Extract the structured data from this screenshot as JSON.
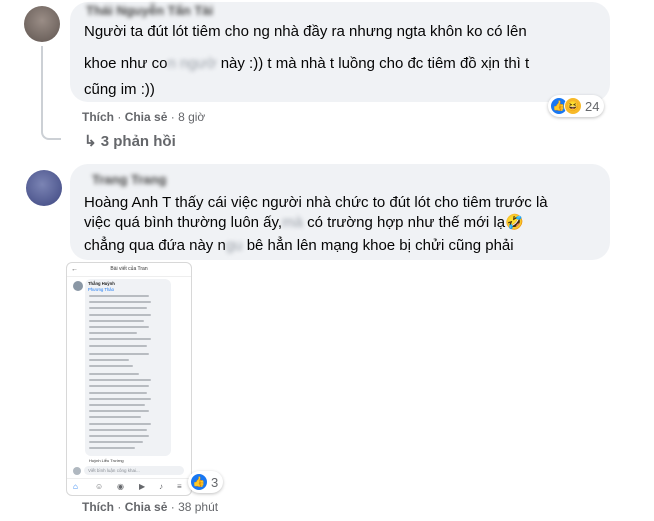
{
  "comment1": {
    "author": "Thái Nguyễn Tấn Tài",
    "lines": [
      "Người ta đút lót tiêm cho ng nhà đầy ra nhưng ngta khôn ko có lên",
      "khoe như co",
      "này :)) t mà nhà t luồng cho đc tiêm đồ xịn thì t",
      "cũng im :))"
    ],
    "blurred_fragment": "n ngườ",
    "like_label": "Thích",
    "share_label": "Chia sẻ",
    "time": "8 giờ",
    "reaction_count": "24",
    "reaction_icons": [
      "like-icon",
      "haha-icon"
    ],
    "replies_label": "3 phản hồi"
  },
  "comment2": {
    "author": "Trang Trang",
    "lines": [
      "Hoàng Anh T thấy cái việc người nhà chức to đút lót cho tiêm trước là",
      "việc quá bình thường luôn ấy,",
      "có trường hợp như thế mới lạ",
      "chẳng qua đứa này n",
      "bê hẳn lên mạng khoe bị chửi cũng phải"
    ],
    "blur_a": "mà",
    "blur_b": "gu",
    "mention_prefix": "Hoàng Anh",
    "like_label": "Thích",
    "share_label": "Chia sẻ",
    "time": "38 phút",
    "reaction_count": "3",
    "reaction_icons": [
      "like-icon"
    ]
  },
  "embedded_shot": {
    "header_title": "Bài viết của Tran",
    "commenter": "Thắng Huỳnh",
    "mention": "Phương Thảo",
    "reply_name": "Huỳnh Liễu Trường",
    "input_placeholder": "Viết bình luận công khai..."
  },
  "colors": {
    "bubble": "#f0f2f5",
    "meta": "#65676b",
    "like_blue": "#1877f2",
    "haha_yellow": "#f7b928"
  }
}
